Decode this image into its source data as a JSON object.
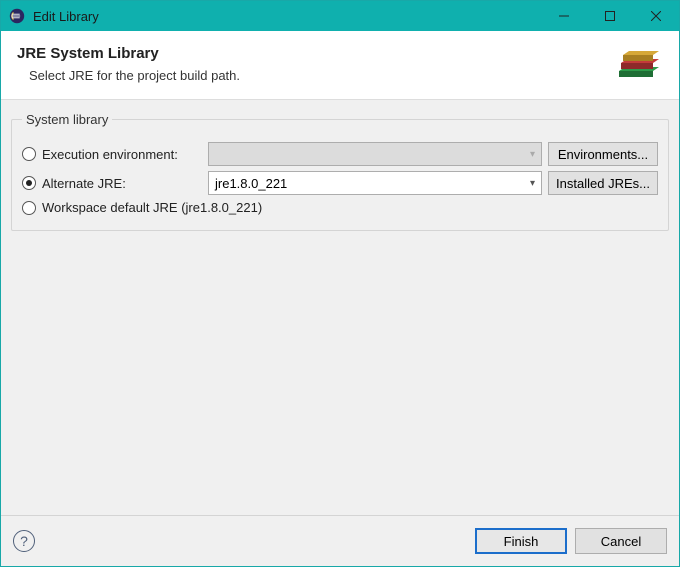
{
  "window": {
    "title": "Edit Library"
  },
  "header": {
    "title": "JRE System Library",
    "subtitle": "Select JRE for the project build path."
  },
  "group": {
    "legend": "System library",
    "exec_env": {
      "label": "Execution environment:",
      "selected": false,
      "combo_value": "",
      "button": "Environments..."
    },
    "alternate": {
      "label": "Alternate JRE:",
      "selected": true,
      "combo_value": "jre1.8.0_221",
      "button": "Installed JREs..."
    },
    "workspace": {
      "label": "Workspace default JRE (jre1.8.0_221)",
      "selected": false
    }
  },
  "footer": {
    "finish": "Finish",
    "cancel": "Cancel"
  }
}
